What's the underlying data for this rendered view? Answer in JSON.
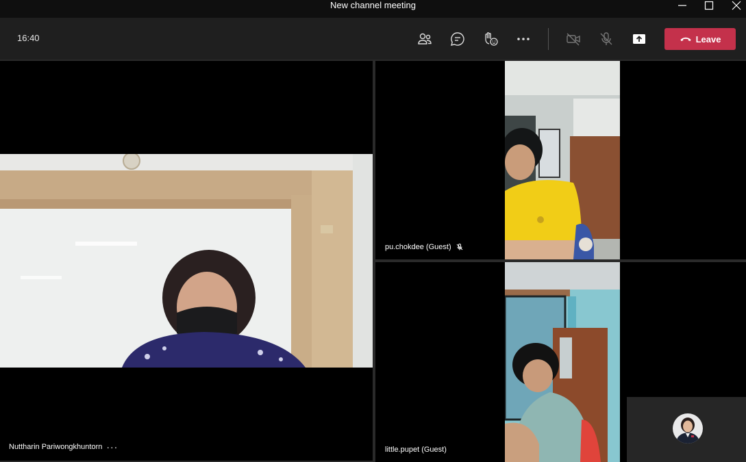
{
  "window": {
    "title": "New channel meeting",
    "controls": [
      "minimize",
      "maximize",
      "close"
    ]
  },
  "toolbar": {
    "time": "16:40",
    "buttons": [
      "people-icon",
      "chat-icon",
      "raise-hand-icon",
      "more-options-icon",
      "camera-off-icon",
      "mic-muted-icon",
      "share-tray-icon"
    ],
    "leave_label": "Leave",
    "leave_color": "#c4314b"
  },
  "participants": [
    {
      "name": "Nuttharin Pariwongkhuntorn",
      "more": "···"
    },
    {
      "name": "pu.chokdee (Guest)",
      "muted": true
    },
    {
      "name": "little.pupet (Guest)"
    }
  ]
}
